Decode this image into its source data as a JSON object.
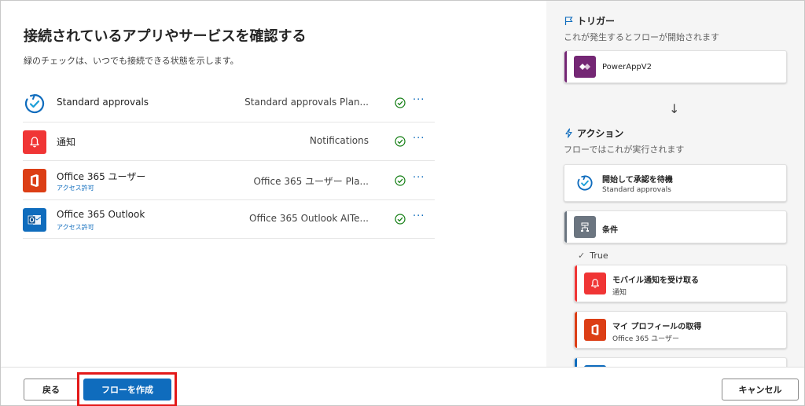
{
  "main": {
    "title": "接続されているアプリやサービスを確認する",
    "subtitle": "緑のチェックは、いつでも接続できる状態を示します。",
    "connections": [
      {
        "name": "Standard approvals",
        "sub": "",
        "connection": "Standard approvals Plan...",
        "icon": "approvals-icon"
      },
      {
        "name": "通知",
        "sub": "",
        "connection": "Notifications",
        "icon": "bell-icon"
      },
      {
        "name": "Office 365 ユーザー",
        "sub": "アクセス許可",
        "connection": "Office 365 ユーザー Pla...",
        "icon": "office-icon"
      },
      {
        "name": "Office 365 Outlook",
        "sub": "アクセス許可",
        "connection": "Office 365 Outlook AITe...",
        "icon": "outlook-icon"
      }
    ],
    "more_label": "···"
  },
  "flow": {
    "trigger_title": "トリガー",
    "trigger_sub": "これが発生するとフローが開始されます",
    "trigger_card": {
      "title": "PowerAppV2"
    },
    "arrow": "↓",
    "action_title": "アクション",
    "action_sub": "フローではこれが実行されます",
    "cards": [
      {
        "title": "開始して承認を待機",
        "sub": "Standard approvals"
      },
      {
        "title": "条件",
        "sub": ""
      },
      {
        "title": "モバイル通知を受け取る",
        "sub": "通知"
      },
      {
        "title": "マイ プロフィールの取得",
        "sub": "Office 365 ユーザー"
      }
    ],
    "true_label": "True"
  },
  "footer": {
    "back_label": "戻る",
    "create_label": "フローを作成",
    "cancel_label": "キャンセル"
  },
  "colors": {
    "primary": "#0f6cbd",
    "success": "#107c10",
    "powerapps": "#742774",
    "notify": "#f03535",
    "office": "#dc3e15",
    "outlook": "#0f6cbd",
    "highlight": "#e31919"
  }
}
